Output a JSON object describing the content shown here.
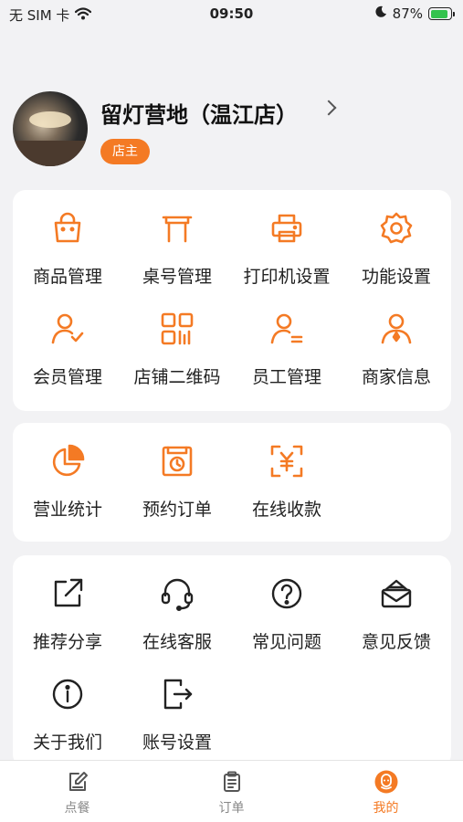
{
  "status_bar": {
    "carrier": "无 SIM 卡",
    "time": "09:50",
    "battery": "87%",
    "battery_level": 0.87,
    "icons": [
      "wifi-icon",
      "moon-icon",
      "battery-icon"
    ]
  },
  "profile": {
    "shop_name": "留灯营地（温江店）",
    "role": "店主"
  },
  "cards": [
    {
      "items": [
        {
          "label": "商品管理",
          "icon": "bag-icon"
        },
        {
          "label": "桌号管理",
          "icon": "table-icon"
        },
        {
          "label": "打印机设置",
          "icon": "printer-icon"
        },
        {
          "label": "功能设置",
          "icon": "gear-icon"
        },
        {
          "label": "会员管理",
          "icon": "member-icon"
        },
        {
          "label": "店铺二维码",
          "icon": "qrcode-icon"
        },
        {
          "label": "员工管理",
          "icon": "staff-icon"
        },
        {
          "label": "商家信息",
          "icon": "merchant-icon"
        }
      ]
    },
    {
      "items": [
        {
          "label": "营业统计",
          "icon": "pie-chart-icon"
        },
        {
          "label": "预约订单",
          "icon": "reservation-icon"
        },
        {
          "label": "在线收款",
          "icon": "yuan-scan-icon"
        }
      ]
    },
    {
      "items": [
        {
          "label": "推荐分享",
          "icon": "share-icon"
        },
        {
          "label": "在线客服",
          "icon": "headset-icon"
        },
        {
          "label": "常见问题",
          "icon": "question-icon"
        },
        {
          "label": "意见反馈",
          "icon": "feedback-icon"
        },
        {
          "label": "关于我们",
          "icon": "info-icon"
        },
        {
          "label": "账号设置",
          "icon": "logout-icon"
        }
      ]
    }
  ],
  "tabbar": [
    {
      "label": "点餐",
      "icon": "edit-icon",
      "active": false
    },
    {
      "label": "订单",
      "icon": "clipboard-icon",
      "active": false
    },
    {
      "label": "我的",
      "icon": "profile-icon",
      "active": true
    }
  ],
  "colors": {
    "accent": "#f47a24",
    "background": "#f2f2f4",
    "card": "#ffffff",
    "inactive_tab": "#888888"
  }
}
